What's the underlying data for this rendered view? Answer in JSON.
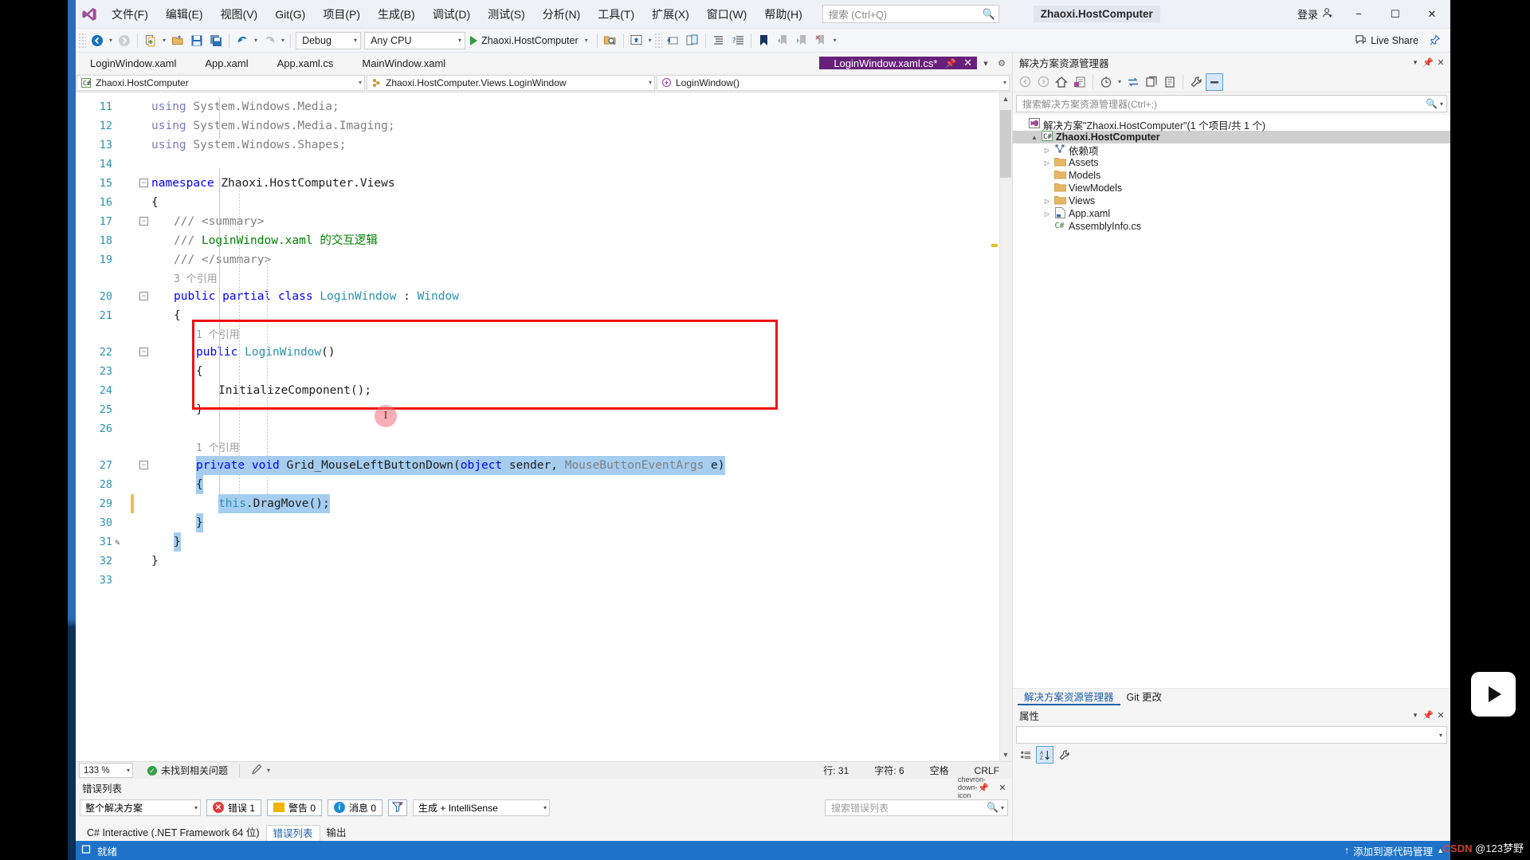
{
  "titlebar": {
    "logo_icon": "visual-studio-logo",
    "menus": [
      "文件(F)",
      "编辑(E)",
      "视图(V)",
      "Git(G)",
      "项目(P)",
      "生成(B)",
      "调试(D)",
      "测试(S)",
      "分析(N)",
      "工具(T)",
      "扩展(X)",
      "窗口(W)",
      "帮助(H)"
    ],
    "search_placeholder": "搜索 (Ctrl+Q)",
    "search_icon": "search-icon",
    "project_badge": "Zhaoxi.HostComputer",
    "signin_label": "登录",
    "signin_icon": "account-add-icon",
    "minimize_icon": "−",
    "maximize_icon": "☐",
    "close_icon": "✕"
  },
  "toolbar": {
    "back_icon": "navigate-back-icon",
    "forward_icon": "navigate-forward-icon",
    "new_item_icon": "new-item-icon",
    "open_icon": "open-file-icon",
    "save_icon": "save-icon",
    "save_all_icon": "save-all-icon",
    "undo_icon": "undo-icon",
    "redo_icon": "redo-icon",
    "config_value": "Debug",
    "platform_value": "Any CPU",
    "run_label": "Zhaoxi.HostComputer",
    "run_icon": "play-icon",
    "icons_right": [
      "find-in-files-icon",
      "preview-window-icon",
      "navigate-to-icon",
      "toggle-panel-icon",
      "indent-icon",
      "comment-icon",
      "bookmark-icon",
      "prev-bookmark-icon",
      "next-bookmark-icon",
      "clear-bookmarks-icon"
    ],
    "liveshare_label": "Live Share",
    "liveshare_icon": "live-share-icon",
    "pin_icon": "pin-icon"
  },
  "doctabs": {
    "items": [
      {
        "label": "LoginWindow.xaml",
        "active": false
      },
      {
        "label": "App.xaml",
        "active": false
      },
      {
        "label": "App.xaml.cs",
        "active": false
      },
      {
        "label": "MainWindow.xaml",
        "active": false
      },
      {
        "label": "LoginWindow.xaml.cs*",
        "active": true
      }
    ],
    "pin_icon": "pin-icon",
    "close_icon": "✕",
    "overflow_icon": "chevron-down-icon",
    "settings_icon": "gear-icon"
  },
  "navbar": {
    "project": "Zhaoxi.HostComputer",
    "project_icon": "csharp-project-icon",
    "type": "Zhaoxi.HostComputer.Views.LoginWindow",
    "type_icon": "class-icon",
    "member": "LoginWindow()",
    "member_icon": "method-icon"
  },
  "editor": {
    "lines": [
      {
        "num": "11",
        "segments": [
          {
            "t": "using ",
            "c": "usg"
          },
          {
            "t": "System.Windows.Media;",
            "c": "dim"
          }
        ],
        "indent": 0
      },
      {
        "num": "12",
        "segments": [
          {
            "t": "using ",
            "c": "usg"
          },
          {
            "t": "System.Windows.Media.Imaging;",
            "c": "dim"
          }
        ],
        "indent": 0
      },
      {
        "num": "13",
        "segments": [
          {
            "t": "using ",
            "c": "usg"
          },
          {
            "t": "System.Windows.Shapes;",
            "c": "dim"
          }
        ],
        "indent": 0
      },
      {
        "num": "14",
        "segments": [],
        "indent": 0
      },
      {
        "num": "15",
        "segments": [
          {
            "t": "namespace ",
            "c": "kw"
          },
          {
            "t": "Zhaoxi.HostComputer.Views",
            "c": "ns"
          }
        ],
        "indent": 0,
        "fold": "−"
      },
      {
        "num": "16",
        "segments": [
          {
            "t": "{",
            "c": "ns"
          }
        ],
        "indent": 0
      },
      {
        "num": "17",
        "segments": [
          {
            "t": "/// <summary>",
            "c": "dim"
          }
        ],
        "indent": 1,
        "fold": "−"
      },
      {
        "num": "18",
        "segments": [
          {
            "t": "/// ",
            "c": "dim"
          },
          {
            "t": "LoginWindow.xaml ",
            "c": "cmt"
          },
          {
            "t": "的交互逻辑",
            "c": "cmt"
          }
        ],
        "indent": 1
      },
      {
        "num": "19",
        "segments": [
          {
            "t": "/// </summary>",
            "c": "dim"
          }
        ],
        "indent": 1
      },
      {
        "num": "",
        "segments": [
          {
            "t": "3 个引用",
            "c": "refcnt"
          }
        ],
        "indent": 1,
        "isref": true
      },
      {
        "num": "20",
        "segments": [
          {
            "t": "public partial class ",
            "c": "kw"
          },
          {
            "t": "LoginWindow",
            "c": "type"
          },
          {
            "t": " : ",
            "c": "ns"
          },
          {
            "t": "Window",
            "c": "type"
          }
        ],
        "indent": 1,
        "fold": "−"
      },
      {
        "num": "21",
        "segments": [
          {
            "t": "{",
            "c": "ns"
          }
        ],
        "indent": 1
      },
      {
        "num": "",
        "segments": [
          {
            "t": "1 个引用",
            "c": "refcnt"
          }
        ],
        "indent": 2,
        "isref": true
      },
      {
        "num": "22",
        "segments": [
          {
            "t": "public ",
            "c": "kw"
          },
          {
            "t": "LoginWindow",
            "c": "type"
          },
          {
            "t": "()",
            "c": "ns"
          }
        ],
        "indent": 2,
        "fold": "−"
      },
      {
        "num": "23",
        "segments": [
          {
            "t": "{",
            "c": "ns"
          }
        ],
        "indent": 2
      },
      {
        "num": "24",
        "segments": [
          {
            "t": "InitializeComponent();",
            "c": "ns"
          }
        ],
        "indent": 3
      },
      {
        "num": "25",
        "segments": [
          {
            "t": "}",
            "c": "ns"
          }
        ],
        "indent": 2
      },
      {
        "num": "26",
        "segments": [],
        "indent": 2
      },
      {
        "num": "",
        "segments": [
          {
            "t": "1 个引用",
            "c": "refcnt"
          }
        ],
        "indent": 2,
        "isref": true
      },
      {
        "num": "27",
        "segments": [
          {
            "t": "private void ",
            "c": "kw"
          },
          {
            "t": "Grid_MouseLeftButtonDown",
            "c": "ns"
          },
          {
            "t": "(",
            "c": "ns"
          },
          {
            "t": "object",
            "c": "kw"
          },
          {
            "t": " sender, ",
            "c": "ns"
          },
          {
            "t": "MouseButtonEventArgs",
            "c": "dim"
          },
          {
            "t": " e)",
            "c": "ns"
          }
        ],
        "indent": 2,
        "fold": "−",
        "selected": true
      },
      {
        "num": "28",
        "segments": [
          {
            "t": "{",
            "c": "ns"
          }
        ],
        "indent": 2,
        "selected": true
      },
      {
        "num": "29",
        "segments": [
          {
            "t": "this",
            "c": "kw2"
          },
          {
            "t": ".DragMove();",
            "c": "ns"
          }
        ],
        "indent": 3,
        "selected": true,
        "changed": true
      },
      {
        "num": "30",
        "segments": [
          {
            "t": "}",
            "c": "ns"
          }
        ],
        "indent": 2,
        "selected": true
      },
      {
        "num": "31",
        "segments": [
          {
            "t": "}",
            "c": "ns"
          }
        ],
        "indent": 1,
        "selected": true,
        "pencil": true
      },
      {
        "num": "32",
        "segments": [
          {
            "t": "}",
            "c": "ns"
          }
        ],
        "indent": 0
      },
      {
        "num": "33",
        "segments": [],
        "indent": 0
      }
    ],
    "annotation_box_color": "#ee1111",
    "selection_color": "#a5cdf0"
  },
  "editor_status": {
    "zoom": "133 %",
    "issues": "未找到相关问题",
    "issues_icon": "check-circle-icon",
    "pen_icon": "pen-icon",
    "line_label": "行: 31",
    "col_label": "字符: 6",
    "space_label": "空格",
    "eol_label": "CRLF"
  },
  "error_list": {
    "title": "错误列表",
    "scope": "整个解决方案",
    "errors_label": "错误 1",
    "warnings_label": "警告 0",
    "messages_label": "消息 0",
    "filter_icon": "filter-icon",
    "build_filter": "生成 + IntelliSense",
    "search_placeholder": "搜索错误列表",
    "search_icon": "search-icon",
    "dropdown_icon": "chevron-down-icon",
    "pin_icon": "pin-icon",
    "close_icon": "✕"
  },
  "tool_tabs": [
    {
      "label": "C# Interactive (.NET Framework 64 位)",
      "active": false
    },
    {
      "label": "错误列表",
      "active": true
    },
    {
      "label": "输出",
      "active": false
    }
  ],
  "solution_explorer": {
    "title": "解决方案资源管理器",
    "dropdown_icon": "chevron-down-icon",
    "pin_icon": "pin-icon",
    "close_icon": "✕",
    "toolbar_icons": [
      "back-icon",
      "forward-icon",
      "home-icon",
      "pending-changes-icon",
      "history-icon",
      "sync-with-active-doc-icon",
      "refresh-icon",
      "collapse-all-icon",
      "properties-icon",
      "show-all-files-icon"
    ],
    "search_placeholder": "搜索解决方案资源管理器(Ctrl+;)",
    "search_icon": "search-icon",
    "solution_label": "解决方案\"Zhaoxi.HostComputer\"(1 个项目/共 1 个)",
    "solution_icon": "solution-icon",
    "tree": [
      {
        "label": "Zhaoxi.HostComputer",
        "icon": "csharp-project-icon",
        "depth": 1,
        "twist": "▲",
        "bold": true,
        "selected": true
      },
      {
        "label": "依赖项",
        "icon": "dependencies-icon",
        "depth": 2,
        "twist": "▷"
      },
      {
        "label": "Assets",
        "icon": "folder-icon",
        "depth": 2,
        "twist": "▷"
      },
      {
        "label": "Models",
        "icon": "folder-icon",
        "depth": 2,
        "twist": ""
      },
      {
        "label": "ViewModels",
        "icon": "folder-icon",
        "depth": 2,
        "twist": ""
      },
      {
        "label": "Views",
        "icon": "folder-icon",
        "depth": 2,
        "twist": "▷"
      },
      {
        "label": "App.xaml",
        "icon": "xaml-file-icon",
        "depth": 2,
        "twist": "▷"
      },
      {
        "label": "AssemblyInfo.cs",
        "icon": "csharp-file-icon",
        "depth": 2,
        "twist": ""
      }
    ],
    "panel_tabs": [
      {
        "label": "解决方案资源管理器",
        "active": true
      },
      {
        "label": "Git 更改",
        "active": false
      }
    ]
  },
  "properties": {
    "title": "属性",
    "dropdown_icon": "chevron-down-icon",
    "pin_icon": "pin-icon",
    "close_icon": "✕",
    "toolbar_icons": [
      "categorized-icon",
      "alphabetical-icon",
      "properties-wrench-icon"
    ]
  },
  "statusbar": {
    "ready_icon": "ready-flag-icon",
    "ready_label": "就绪",
    "upload_icon": "arrow-up-icon",
    "source_control_label": "添加到源代码管理",
    "source_control_caret": "▲"
  },
  "overlay": {
    "float_button_icon": "play-button",
    "watermark_csdn": "CSDN",
    "watermark_author": "@123梦野"
  }
}
